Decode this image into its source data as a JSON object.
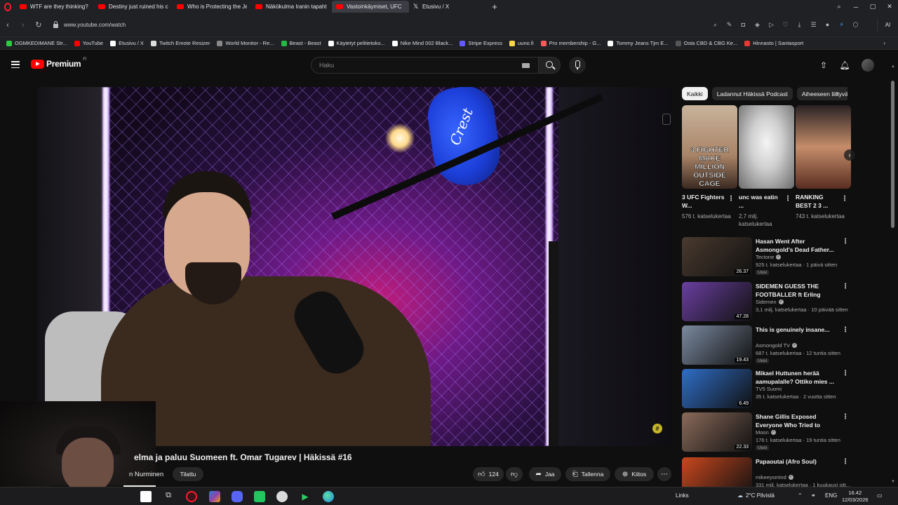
{
  "browser": {
    "tabs": [
      {
        "title": "WTF are they thinking? - Y",
        "favicon": "youtube-icon",
        "active": false
      },
      {
        "title": "Destiny just ruined his car",
        "favicon": "youtube-icon",
        "active": false
      },
      {
        "title": "Who is Protecting the Jeff",
        "favicon": "youtube-icon",
        "active": false
      },
      {
        "title": "Näkökulma Iranin tapaht",
        "favicon": "youtube-icon",
        "active": false
      },
      {
        "title": "Vastoinkäymiset, UFC",
        "favicon": "youtube-icon",
        "active": true
      },
      {
        "title": "Etusivu / X",
        "favicon": "x-icon",
        "active": false
      }
    ],
    "url": "www.youtube.com/watch",
    "ai_label": "AI",
    "bookmarks": [
      {
        "label": "OGMKEDIMANE Str...",
        "color": "#2ecc40"
      },
      {
        "label": "YouTube",
        "color": "#ff0000"
      },
      {
        "label": "Etusivu / X",
        "color": "#ffffff"
      },
      {
        "label": "Twitch Emote Resizer",
        "color": "#dddddd"
      },
      {
        "label": "World Monitor - Re...",
        "color": "#888888"
      },
      {
        "label": "Beast - Beast",
        "color": "#22bb44"
      },
      {
        "label": "Käytetyt pelitietoko...",
        "color": "#ffffff"
      },
      {
        "label": "Nike Mind 002 Black...",
        "color": "#ffffff"
      },
      {
        "label": "Stripe Express",
        "color": "#635bff"
      },
      {
        "label": "uuno.fi",
        "color": "#ffd54a"
      },
      {
        "label": "Pro membership - G...",
        "color": "#ff5a5a"
      },
      {
        "label": "Tommy Jeans Tjm E...",
        "color": "#ffffff"
      },
      {
        "label": "Osta CBD & CBG Ke...",
        "color": "#555555"
      },
      {
        "label": "Hinnasto | Santasport",
        "color": "#e53935"
      }
    ]
  },
  "youtube": {
    "logo_text": "Premium",
    "logo_suffix": "FI",
    "search_placeholder": "Haku"
  },
  "video": {
    "title": "elma ja paluu Suomeen ft. Omar Tugarev | Häkissä #16",
    "channel": "n Nurminen",
    "subscribe_label": "Tilattu",
    "likes": "124",
    "share_label": "Jaa",
    "save_label": "Tallenna",
    "thanks_label": "Kiitos"
  },
  "sidebar": {
    "chips": [
      "Kaikki",
      "Ladannut Häkissä Podcast",
      "Aiheeseen liittyvät"
    ],
    "shorts": [
      {
        "title": "3 UFC Fighters W...",
        "views": "576 t. katselukertaa",
        "thumb_text": "3 FIGHTER MAKE MILLION OUTSIDE CAGE"
      },
      {
        "title": "unc was eatin ...",
        "views": "2,7 milj. katselukertaa",
        "thumb_text": ""
      },
      {
        "title": "RANKING BEST 2 3 ...",
        "views": "743 t. katselukertaa",
        "thumb_text": ""
      }
    ],
    "videos": [
      {
        "title": "Hasan Went After Asmongold's Dead Father...",
        "channel": "Tectone",
        "verified": true,
        "meta": "925 t. katselukertaa · 1 päivä sitten",
        "badge": "Uusi",
        "duration": "26.37",
        "thumb_color": "#4a3a2e"
      },
      {
        "title": "SIDEMEN GUESS THE FOOTBALLER ft Erling Haaland",
        "channel": "Sidemen",
        "verified": true,
        "meta": "3,1 milj. katselukertaa · 10 päivää sitten",
        "badge": "",
        "duration": "47.28",
        "thumb_color": "#6a3fa0"
      },
      {
        "title": "This is genuinely insane...",
        "channel": "Asmongold TV",
        "verified": true,
        "meta": "687 t. katselukertaa · 12 tuntia sitten",
        "badge": "Uusi",
        "duration": "19.43",
        "thumb_color": "#7b8aa0"
      },
      {
        "title": "Mikael Huttunen herää aamupalalle? Ottiko mies ...",
        "channel": "TV5 Suomi",
        "verified": false,
        "meta": "35 t. katselukertaa · 2 vuotta sitten",
        "badge": "",
        "duration": "6.49",
        "thumb_color": "#2f6ec8"
      },
      {
        "title": "Shane Gillis Exposed Everyone Who Tried to Destroy Him",
        "channel": "Moon",
        "verified": true,
        "meta": "176 t. katselukertaa · 19 tuntia sitten",
        "badge": "Uusi",
        "duration": "22.33",
        "thumb_color": "#8a6a5a"
      },
      {
        "title": "Papaoutai (Afro Soul)",
        "channel": "mikeeysmind",
        "verified": true,
        "meta": "331 milj. katselukertaa · 1 kuukausi sitt...",
        "badge": "",
        "duration": "",
        "thumb_color": "#c9471e"
      }
    ]
  },
  "taskbar": {
    "links_label": "Links",
    "weather": "2°C Pilvistä",
    "language": "ENG",
    "time": "16.42",
    "date": "12/03/2026"
  }
}
